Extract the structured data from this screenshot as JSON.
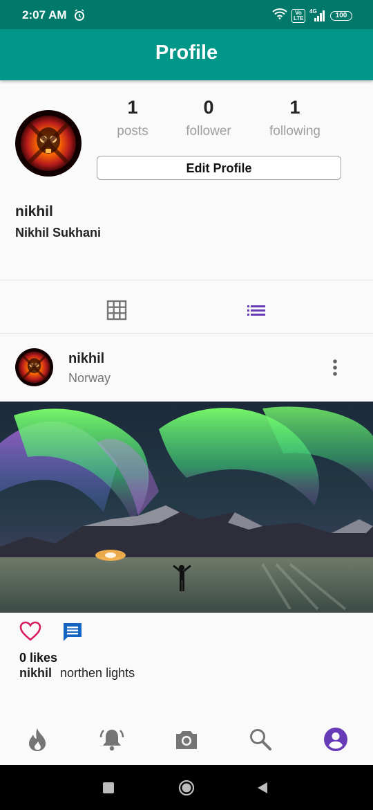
{
  "status_bar": {
    "time": "2:07 AM",
    "volte_label": "Vo LTE",
    "network_label": "4G",
    "battery": "100",
    "icons": [
      "alarm-icon",
      "wifi-icon",
      "volte-icon",
      "signal-icon",
      "battery-icon"
    ]
  },
  "app_bar": {
    "title": "Profile"
  },
  "profile": {
    "username": "nikhil",
    "full_name": "Nikhil Sukhani",
    "stats": [
      {
        "value": "1",
        "label": "posts"
      },
      {
        "value": "0",
        "label": "follower"
      },
      {
        "value": "1",
        "label": "following"
      }
    ],
    "edit_button_label": "Edit Profile"
  },
  "view_toggle": {
    "options": [
      "grid-icon",
      "list-icon"
    ],
    "selected": "list-icon"
  },
  "post": {
    "username": "nikhil",
    "location": "Norway",
    "likes_text": "0 likes",
    "caption_user": "nikhil",
    "caption_text": "northen lights"
  },
  "bottom_nav": {
    "items": [
      "flame-icon",
      "bell-icon",
      "camera-icon",
      "search-icon",
      "account-icon"
    ],
    "selected": "account-icon"
  },
  "colors": {
    "status_bar": "#00796b",
    "app_bar": "#009688",
    "accent_purple": "#673ab7",
    "like_pink": "#d81b60",
    "comment_blue": "#1565c0"
  }
}
